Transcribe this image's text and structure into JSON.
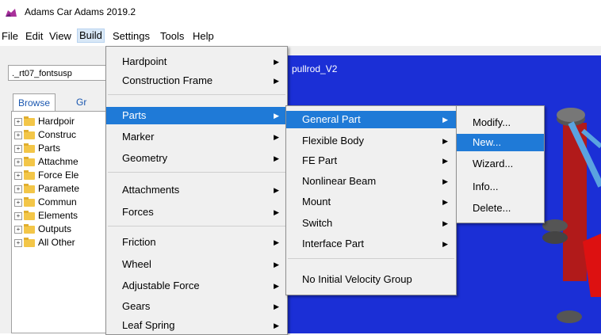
{
  "window": {
    "title": "Adams Car Adams 2019.2"
  },
  "menubar": [
    "File",
    "Edit",
    "View",
    "Build",
    "Settings",
    "Tools",
    "Help"
  ],
  "left_panel": {
    "file_combo": "._rt07_fontsusp",
    "tabs": [
      "Browse",
      "Gr"
    ],
    "tree": [
      "Hardpoir",
      "Construc",
      "Parts",
      "Attachme",
      "Force Ele",
      "Paramete",
      "Commun",
      "Elements",
      "Outputs",
      "All Other"
    ]
  },
  "viewport": {
    "label": "pullrod_V2"
  },
  "build_menu": {
    "items": [
      {
        "label": "Hardpoint",
        "sub": true
      },
      {
        "label": "Construction Frame",
        "sub": true
      },
      {
        "label": "Parts",
        "sub": true,
        "highlighted": true
      },
      {
        "label": "Marker",
        "sub": true
      },
      {
        "label": "Geometry",
        "sub": true
      },
      {
        "label": "Attachments",
        "sub": true
      },
      {
        "label": "Forces",
        "sub": true
      },
      {
        "label": "Friction",
        "sub": true
      },
      {
        "label": "Wheel",
        "sub": true
      },
      {
        "label": "Adjustable Force",
        "sub": true
      },
      {
        "label": "Gears",
        "sub": true
      },
      {
        "label": "Leaf Spring",
        "sub": true
      }
    ]
  },
  "parts_menu": {
    "items": [
      {
        "label": "General Part",
        "sub": true,
        "highlighted": true
      },
      {
        "label": "Flexible Body",
        "sub": true
      },
      {
        "label": "FE Part",
        "sub": true
      },
      {
        "label": "Nonlinear Beam",
        "sub": true
      },
      {
        "label": "Mount",
        "sub": true
      },
      {
        "label": "Switch",
        "sub": true
      },
      {
        "label": "Interface Part",
        "sub": true
      },
      {
        "label": "No Initial Velocity Group",
        "sub": false
      }
    ]
  },
  "general_part_menu": {
    "items": [
      {
        "label": "Modify...",
        "highlighted": false
      },
      {
        "label": "New...",
        "highlighted": true
      },
      {
        "label": "Wizard...",
        "highlighted": false
      },
      {
        "label": "Info...",
        "highlighted": false
      },
      {
        "label": "Delete...",
        "highlighted": false
      }
    ]
  },
  "colors": {
    "highlight": "#1f7ad7",
    "viewport": "#1b2fd6"
  }
}
